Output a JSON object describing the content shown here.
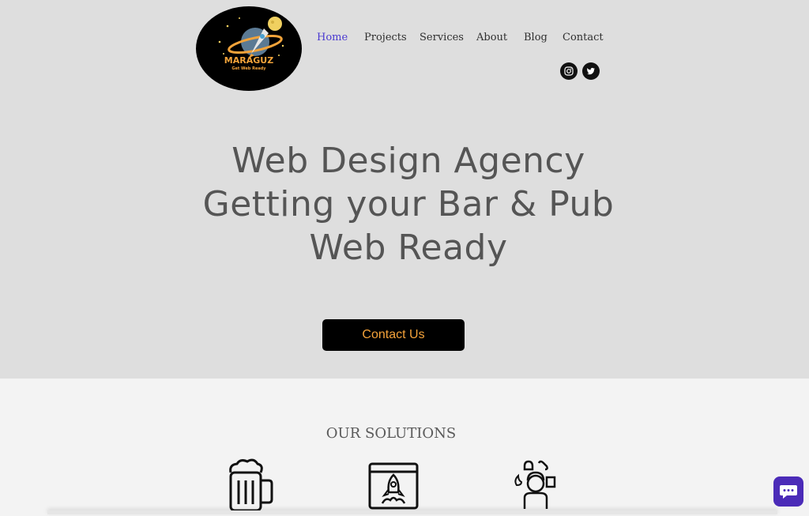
{
  "logo": {
    "name": "MARAGUZ",
    "tagline": "Get Web Ready"
  },
  "nav": {
    "items": [
      {
        "label": "Home",
        "active": true
      },
      {
        "label": "Projects",
        "active": false
      },
      {
        "label": "Services",
        "active": false
      },
      {
        "label": "About",
        "active": false
      },
      {
        "label": "Blog",
        "active": false
      },
      {
        "label": "Contact",
        "active": false
      }
    ],
    "active_color": "#4b3ad1"
  },
  "social": [
    {
      "icon": "instagram-icon"
    },
    {
      "icon": "twitter-icon"
    }
  ],
  "hero": {
    "headline_lines": [
      "Web Design Agency",
      "Getting your Bar & Pub",
      "Web Ready"
    ],
    "cta_label": "Contact Us",
    "cta_text_color": "#f3a23a"
  },
  "solutions": {
    "title": "OUR SOLUTIONS",
    "icons": [
      "beer-mug-icon",
      "rocket-browser-icon",
      "customer-support-icon"
    ]
  },
  "chat": {
    "icon": "chat-icon",
    "color": "#4b2bb8"
  }
}
